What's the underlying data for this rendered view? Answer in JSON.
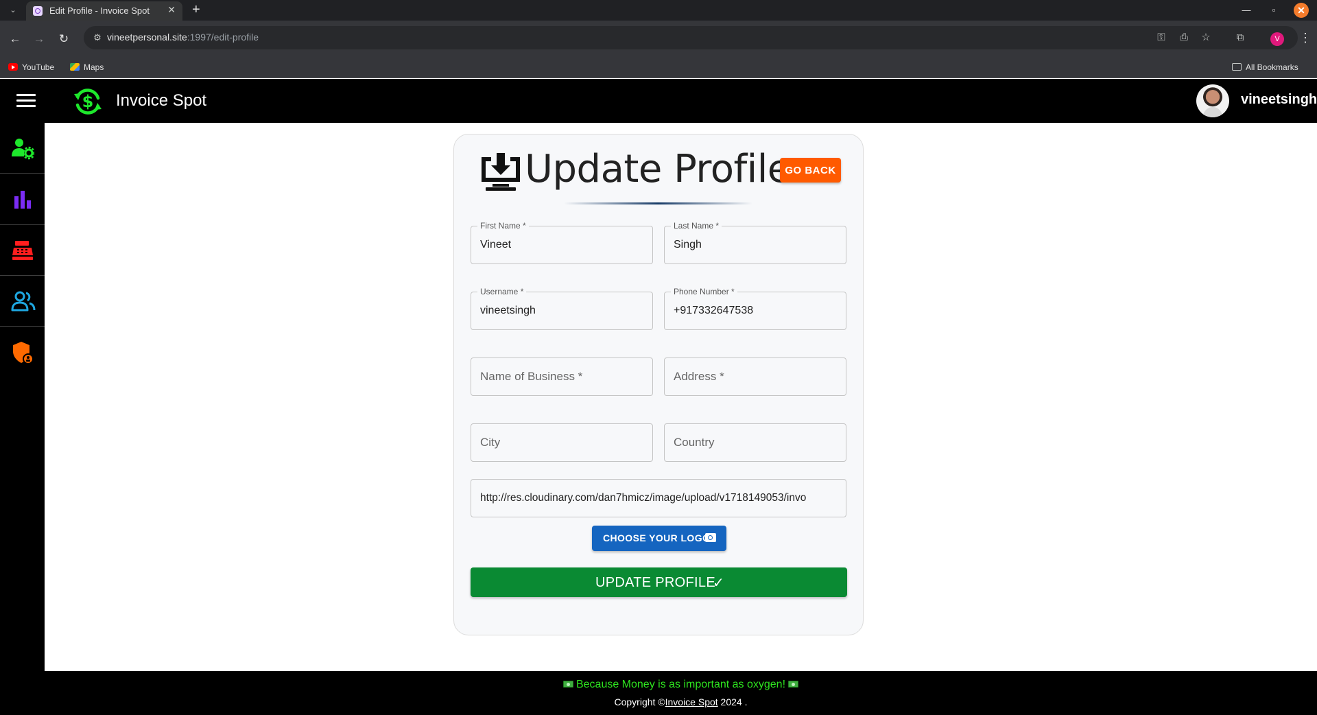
{
  "browser": {
    "tab_title": "Edit Profile - Invoice Spot",
    "url_host": "vineetpersonal.site",
    "url_rest": ":1997/edit-profile",
    "bookmarks": [
      "YouTube",
      "Maps"
    ],
    "all_bookmarks": "All Bookmarks",
    "profile_initial": "V"
  },
  "app": {
    "brand": "Invoice Spot",
    "username": "vineetsingh",
    "accent": "#1ee82c"
  },
  "sidebar": {
    "items": [
      {
        "icon": "user-settings-icon",
        "color": "#1ee82c"
      },
      {
        "icon": "bar-chart-icon",
        "color": "#7b2cf5"
      },
      {
        "icon": "cash-register-icon",
        "color": "#ff1e1e"
      },
      {
        "icon": "users-icon",
        "color": "#1ea7e0"
      },
      {
        "icon": "security-shield-icon",
        "color": "#ff6a00"
      }
    ]
  },
  "form": {
    "title": "Update Profile",
    "go_back": "GO BACK",
    "fields": {
      "first_name": {
        "label": "First Name *",
        "value": "Vineet"
      },
      "last_name": {
        "label": "Last Name *",
        "value": "Singh"
      },
      "username": {
        "label": "Username *",
        "value": "vineetsingh"
      },
      "phone": {
        "label": "Phone Number *",
        "value": "+917332647538"
      },
      "business": {
        "placeholder": "Name of Business *"
      },
      "address": {
        "placeholder": "Address *"
      },
      "city": {
        "placeholder": "City"
      },
      "country": {
        "placeholder": "Country"
      },
      "logo_url": {
        "value": "http://res.cloudinary.com/dan7hmicz/image/upload/v1718149053/invo"
      }
    },
    "choose_logo": "CHOOSE YOUR LOGO",
    "submit": "UPDATE PROFILE",
    "colors": {
      "go_back": "#ff5a00",
      "choose_logo": "#1565c0",
      "submit": "#0a8a33"
    }
  },
  "footer": {
    "motto": "Because Money is as important as oxygen!",
    "copyright_prefix": "Copyright ©",
    "copyright_link": "Invoice Spot",
    "copyright_suffix": " 2024 ."
  }
}
